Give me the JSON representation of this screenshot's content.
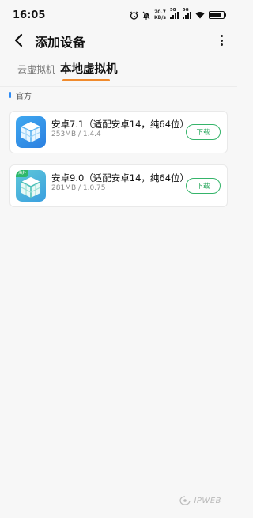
{
  "status_bar": {
    "time": "16:05",
    "net_speed_value": "20.7",
    "net_speed_unit": "KB/s",
    "sim1_label": "5G",
    "sim2_label": "5G",
    "battery_level": 0.85
  },
  "header": {
    "title": "添加设备"
  },
  "tabs": [
    {
      "label": "云虚拟机",
      "active": false
    },
    {
      "label": "本地虚拟机",
      "active": true
    }
  ],
  "section": {
    "label": "官方"
  },
  "items": [
    {
      "title": "安卓7.1（适配安卓14，纯64位）",
      "meta": "253MB / 1.4.4",
      "button": "下载",
      "badge": ""
    },
    {
      "title": "安卓9.0（适配安卓14，纯64位）",
      "meta": "281MB / 1.0.75",
      "button": "下载",
      "badge": "海外"
    }
  ],
  "watermark": {
    "text": "IPWEB"
  },
  "colors": {
    "accent_tab": "#f08a2c",
    "download_green": "#25a65a",
    "section_blue": "#2f8cf5"
  }
}
